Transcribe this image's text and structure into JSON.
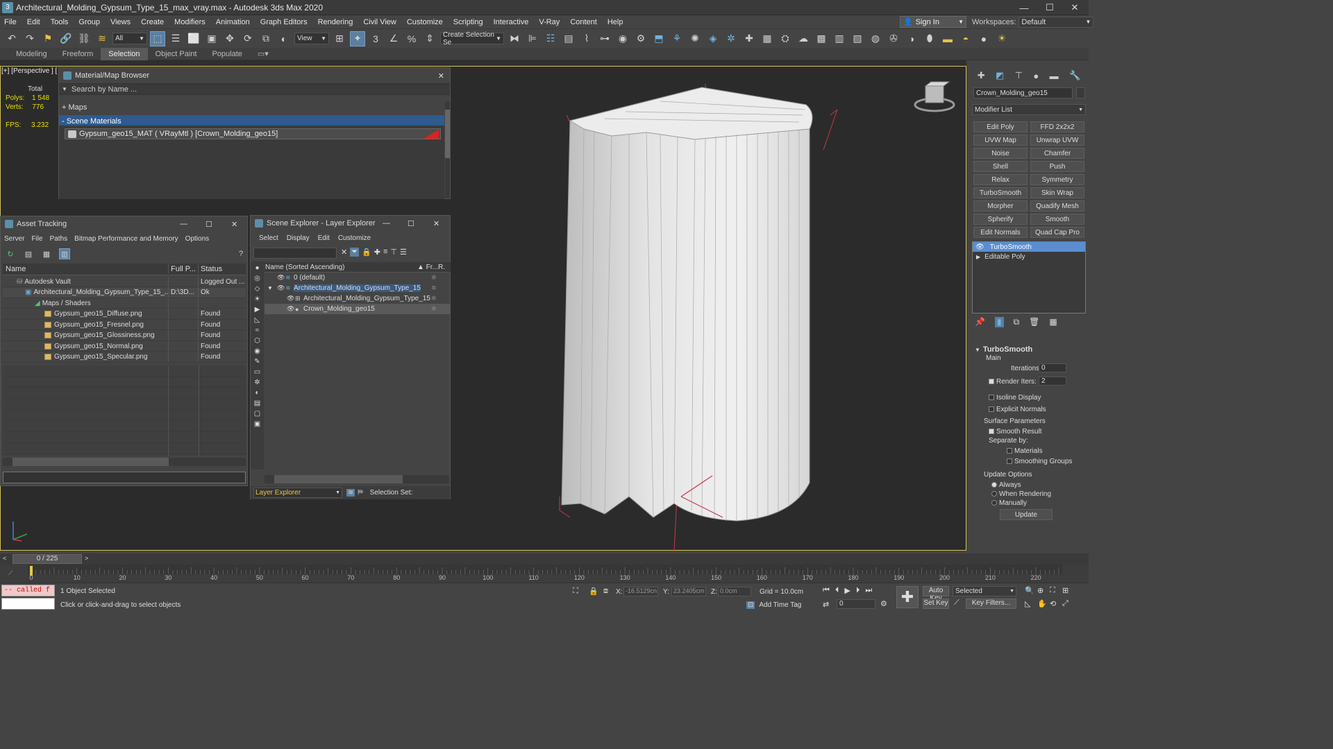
{
  "window": {
    "title": "Architectural_Molding_Gypsum_Type_15_max_vray.max - Autodesk 3ds Max 2020",
    "min": "—",
    "max": "☐",
    "close": "✕"
  },
  "menu": [
    "File",
    "Edit",
    "Tools",
    "Group",
    "Views",
    "Create",
    "Modifiers",
    "Animation",
    "Graph Editors",
    "Rendering",
    "Civil View",
    "Customize",
    "Scripting",
    "Interactive",
    "V-Ray",
    "Content",
    "Help"
  ],
  "signin": "Sign In",
  "workspaces": {
    "label": "Workspaces:",
    "value": "Default"
  },
  "toolbar": {
    "filter": "All",
    "refcoord": "View",
    "selset": "Create Selection Se"
  },
  "ribbon": [
    "Modeling",
    "Freeform",
    "Selection",
    "Object Paint",
    "Populate"
  ],
  "viewport": {
    "label": "[+] [Perspective ] [",
    "stats": {
      "total": "Total",
      "polys_k": "Polys:",
      "polys_v": "1 548",
      "verts_k": "Verts:",
      "verts_v": "776",
      "fps_k": "FPS:",
      "fps_v": "3.232"
    }
  },
  "mmb": {
    "title": "Material/Map Browser",
    "search": "Search by Name ...",
    "maps": "+ Maps",
    "scene": "- Scene Materials",
    "material": "Gypsum_geo15_MAT ( VRayMtl ) [Crown_Molding_geo15]",
    "close": "✕"
  },
  "asset": {
    "title": "Asset Tracking",
    "menu": [
      "Server",
      "File",
      "Paths",
      "Bitmap Performance and Memory",
      "Options"
    ],
    "cols": [
      "Name",
      "Full P...",
      "Status"
    ],
    "rows": [
      {
        "name": "Autodesk Vault",
        "path": "",
        "status": "Logged Out ..."
      },
      {
        "name": "Architectural_Molding_Gypsum_Type_15_...",
        "path": "D:\\3D...",
        "status": "Ok"
      },
      {
        "name": "Maps / Shaders",
        "path": "",
        "status": ""
      },
      {
        "name": "Gypsum_geo15_Diffuse.png",
        "path": "",
        "status": "Found"
      },
      {
        "name": "Gypsum_geo15_Fresnel.png",
        "path": "",
        "status": "Found"
      },
      {
        "name": "Gypsum_geo15_Glossiness.png",
        "path": "",
        "status": "Found"
      },
      {
        "name": "Gypsum_geo15_Normal.png",
        "path": "",
        "status": "Found"
      },
      {
        "name": "Gypsum_geo15_Specular.png",
        "path": "",
        "status": "Found"
      }
    ]
  },
  "scene": {
    "title": "Scene Explorer - Layer Explorer",
    "menu": [
      "Select",
      "Display",
      "Edit",
      "Customize"
    ],
    "col_name": "Name (Sorted Ascending)",
    "col_fr": "▲ Fr...",
    "col_r": "R.",
    "rows": [
      "0 (default)",
      "Architectural_Molding_Gypsum_Type_15",
      "Architectural_Molding_Gypsum_Type_15",
      "Crown_Molding_geo15"
    ],
    "footer_dd": "Layer Explorer",
    "footer_sel": "Selection Set:"
  },
  "cmd": {
    "object_name": "Crown_Molding_geo15",
    "modlist": "Modifier List",
    "buttons": [
      "Edit Poly",
      "FFD 2x2x2",
      "UVW Map",
      "Unwrap UVW",
      "Noise",
      "Chamfer",
      "Shell",
      "Push",
      "Relax",
      "Symmetry",
      "TurboSmooth",
      "Skin Wrap",
      "Morpher",
      "Quadify Mesh",
      "Spherify",
      "Smooth",
      "Edit Normals",
      "Quad Cap Pro"
    ],
    "stack": [
      "TurboSmooth",
      "Editable Poly"
    ],
    "rollout": {
      "title": "TurboSmooth",
      "main": "Main",
      "iterations_k": "Iterations:",
      "iterations_v": "0",
      "render_k": "Render Iters:",
      "render_v": "2",
      "isoline": "Isoline Display",
      "explicit": "Explicit Normals",
      "surface": "Surface Parameters",
      "smooth": "Smooth Result",
      "separate": "Separate by:",
      "materials": "Materials",
      "smgroups": "Smoothing Groups",
      "update_opts": "Update Options",
      "always": "Always",
      "when": "When Rendering",
      "manually": "Manually",
      "update": "Update"
    }
  },
  "timeline": {
    "frame": "0 / 225",
    "ticks": [
      "0",
      "10",
      "20",
      "30",
      "40",
      "50",
      "60",
      "70",
      "80",
      "90",
      "100",
      "110",
      "120",
      "130",
      "140",
      "150",
      "160",
      "170",
      "180",
      "190",
      "200",
      "210",
      "220"
    ]
  },
  "status": {
    "maxscript": "-- called f",
    "selected": "1 Object Selected",
    "prompt": "Click or click-and-drag to select objects",
    "x_k": "X:",
    "x_v": "-16.5129cn",
    "y_k": "Y:",
    "y_v": "23.2405cm",
    "z_k": "Z:",
    "z_v": "0.0cm",
    "grid": "Grid = 10.0cm",
    "addtag": "Add Time Tag",
    "autokey": "Auto Key",
    "setkey": "Set Key",
    "selected_dd": "Selected",
    "keyfilters": "Key Filters...",
    "frame": "0"
  }
}
